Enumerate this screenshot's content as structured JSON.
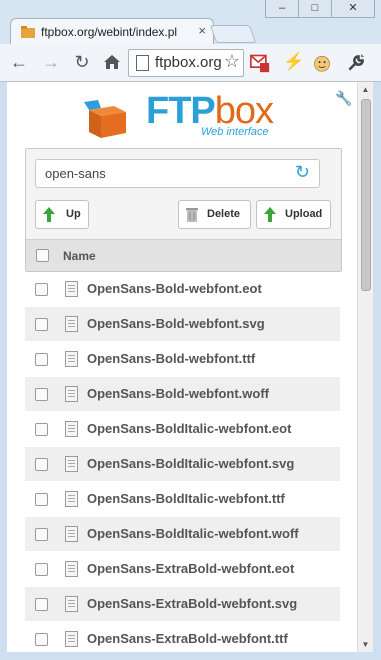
{
  "browser": {
    "tab_title": "ftpbox.org/webint/index.pl",
    "tab_close": "×",
    "window_buttons": [
      "–",
      "□",
      "✕"
    ],
    "omnibox_text": "ftpbox.org",
    "gmail_badge": "4"
  },
  "app": {
    "logo_text_main": "FTP",
    "logo_text_box": "box",
    "logo_subtitle": "Web interface"
  },
  "toolbar": {
    "path": "open-sans",
    "up_label": "Up",
    "delete_label": "Delete",
    "upload_label": "Upload",
    "column_name": "Name"
  },
  "files": [
    "OpenSans-Bold-webfont.eot",
    "OpenSans-Bold-webfont.svg",
    "OpenSans-Bold-webfont.ttf",
    "OpenSans-Bold-webfont.woff",
    "OpenSans-BoldItalic-webfont.eot",
    "OpenSans-BoldItalic-webfont.svg",
    "OpenSans-BoldItalic-webfont.ttf",
    "OpenSans-BoldItalic-webfont.woff",
    "OpenSans-ExtraBold-webfont.eot",
    "OpenSans-ExtraBold-webfont.svg",
    "OpenSans-ExtraBold-webfont.ttf"
  ],
  "colors": {
    "brand_blue": "#2a9fd8",
    "brand_orange": "#e0691a",
    "arrow_green": "#3aa53a",
    "row_alt": "#efefef"
  }
}
